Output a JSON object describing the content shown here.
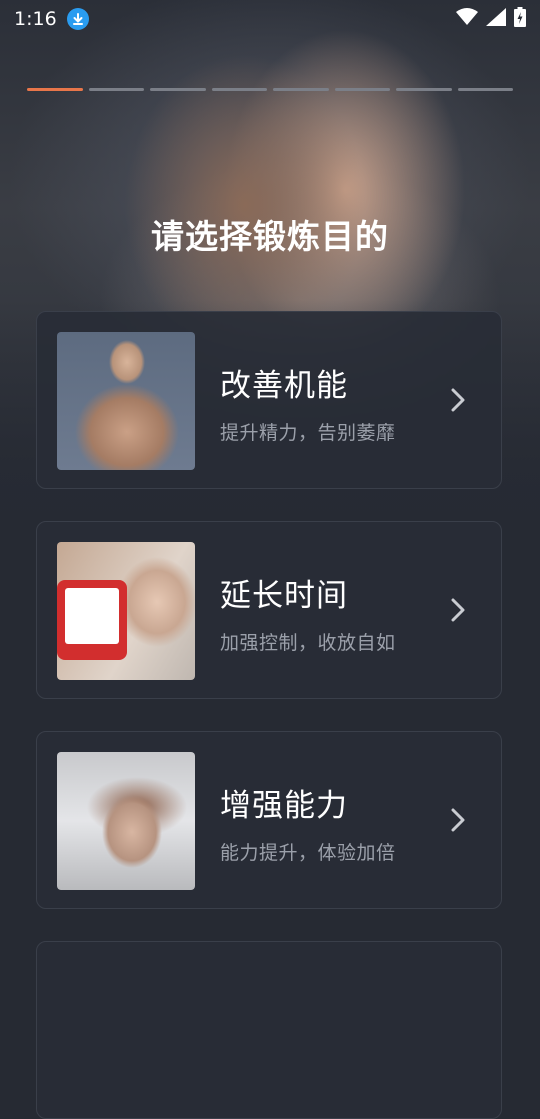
{
  "status_bar": {
    "time": "1:16"
  },
  "onboarding": {
    "total_steps": 8,
    "current_step": 1
  },
  "header": {
    "title": "请选择锻炼目的"
  },
  "options": [
    {
      "title": "改善机能",
      "subtitle": "提升精力，告别萎靡"
    },
    {
      "title": "延长时间",
      "subtitle": "加强控制，收放自如"
    },
    {
      "title": "增强能力",
      "subtitle": "能力提升，体验加倍"
    }
  ],
  "colors": {
    "accent": "#e8764a",
    "background": "#262a33",
    "card": "#282c36"
  }
}
